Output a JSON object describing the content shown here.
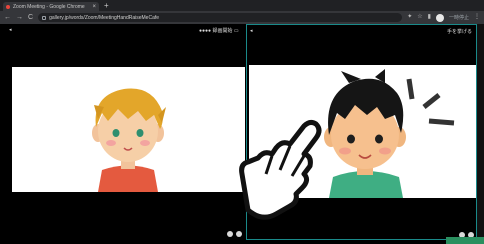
{
  "browser": {
    "tab_title": "Zoom Meeting - Google Chrome",
    "new_tab": "+",
    "url": "gallery.jp/words/Zoom/MeetingHandRaiseMeCafe",
    "back": "←",
    "forward": "→",
    "reload": "C",
    "pause_label": "一時停止"
  },
  "left_tile": {
    "status_label": "●●●● 録画開始 ▭"
  },
  "right_tile": {
    "status_label": "手を挙げる"
  },
  "icons": {
    "tab_close": "×",
    "menu": "⋮"
  },
  "colors": {
    "accent_border": "#1a8a8a",
    "corner_green": "#2a8f5f"
  }
}
